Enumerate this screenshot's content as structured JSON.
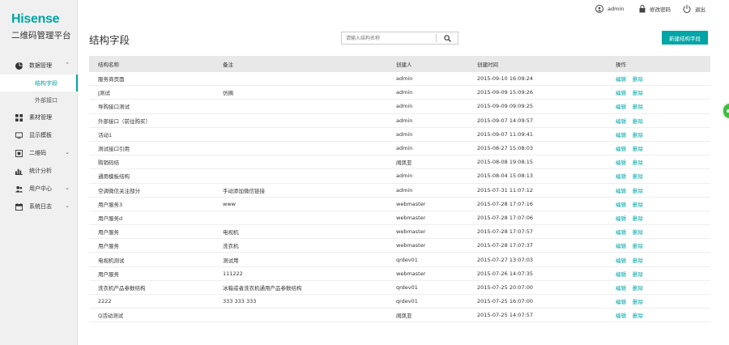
{
  "brand": {
    "logo": "Hisense",
    "subtitle": "二维码管理平台"
  },
  "topbar": {
    "user": "admin",
    "change_password": "修改密码",
    "logout": "退出"
  },
  "sidebar": {
    "items": [
      {
        "label": "数据管理",
        "icon": "pie-chart-icon",
        "expanded": true,
        "children": [
          {
            "label": "结构字段",
            "active": true
          },
          {
            "label": "外部接口",
            "active": false
          }
        ]
      },
      {
        "label": "素材管理",
        "icon": "grid-icon"
      },
      {
        "label": "显示模板",
        "icon": "monitor-icon"
      },
      {
        "label": "二维码",
        "icon": "qrcode-icon",
        "chevron": true
      },
      {
        "label": "统计分析",
        "icon": "bar-chart-icon"
      },
      {
        "label": "用户中心",
        "icon": "users-icon",
        "chevron": true
      },
      {
        "label": "系统日志",
        "icon": "calendar-icon",
        "chevron": true
      }
    ]
  },
  "page": {
    "title": "结构字段",
    "search_placeholder": "请输入结构名称",
    "new_button": "新建结构字段"
  },
  "table": {
    "columns": [
      "结构名称",
      "备注",
      "创建人",
      "创建时间",
      "操作"
    ],
    "edit_label": "编辑",
    "delete_label": "删除",
    "rows": [
      {
        "name": "服务商页面",
        "note": "",
        "creator": "admin",
        "time": "2015-09-10 16:09:24"
      },
      {
        "name": "J测试",
        "note": "仿摘",
        "creator": "admin",
        "time": "2015-09-09 15:09:26"
      },
      {
        "name": "导购接口测试",
        "note": "",
        "creator": "admin",
        "time": "2015-09-09 09:09:25"
      },
      {
        "name": "外部接口（前往购买）",
        "note": "",
        "creator": "admin",
        "time": "2015-09-07 14:09:57"
      },
      {
        "name": "活动1",
        "note": "",
        "creator": "admin",
        "time": "2015-09-07 11:09:41"
      },
      {
        "name": "测试接口引用",
        "note": "",
        "creator": "admin",
        "time": "2015-08-27 15:08:03"
      },
      {
        "name": "购销码结",
        "note": "",
        "creator": "闻凤亚",
        "time": "2015-08-08 19:08:15"
      },
      {
        "name": "通用模板结构",
        "note": "",
        "creator": "admin",
        "time": "2015-08-04 15:08:13"
      },
      {
        "name": "空调微信关注部分",
        "note": "手动添加微信链接",
        "creator": "admin",
        "time": "2015-07-31 11:07:12"
      },
      {
        "name": "用户服务3",
        "note": "www",
        "creator": "webmaster",
        "time": "2015-07-28 17:07:16"
      },
      {
        "name": "用户服务d",
        "note": "",
        "creator": "webmaster",
        "time": "2015-07-28 17:07:06"
      },
      {
        "name": "用户服务",
        "note": "电视机",
        "creator": "webmaster",
        "time": "2015-07-28 17:07:57"
      },
      {
        "name": "用户服务",
        "note": "洗衣机",
        "creator": "webmaster",
        "time": "2015-07-28 17:07:37"
      },
      {
        "name": "电视机测试",
        "note": "测试用",
        "creator": "qrdev01",
        "time": "2015-07-27 13:07:03"
      },
      {
        "name": "用户服务",
        "note": "111222",
        "creator": "webmaster",
        "time": "2015-07-26 14:07:35"
      },
      {
        "name": "洗衣机产品参数结构",
        "note": "冰箱或者洗衣机通用产品参数结构",
        "creator": "qrdev01",
        "time": "2015-07-25 20:07:00"
      },
      {
        "name": "2222",
        "note": "333 333 333",
        "creator": "qrdev01",
        "time": "2015-07-25 16:07:00"
      },
      {
        "name": "Q活动测试",
        "note": "",
        "creator": "闻凤亚",
        "time": "2015-07-25 14:07:57"
      }
    ]
  }
}
